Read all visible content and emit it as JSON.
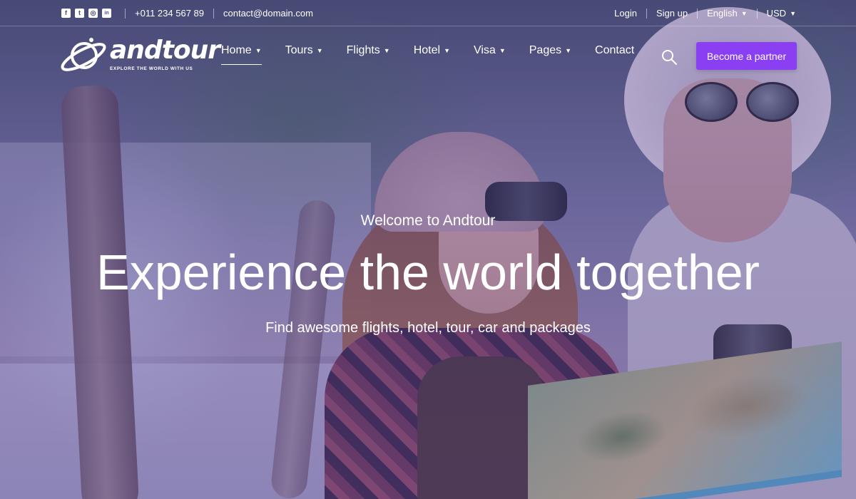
{
  "topbar": {
    "social": [
      {
        "icon": "facebook-icon",
        "glyph": "f"
      },
      {
        "icon": "twitter-icon",
        "glyph": "t"
      },
      {
        "icon": "instagram-icon",
        "glyph": "◎"
      },
      {
        "icon": "linkedin-icon",
        "glyph": "in"
      }
    ],
    "phone": "+011 234 567 89",
    "email": "contact@domain.com",
    "login": "Login",
    "signup": "Sign up",
    "language": "English",
    "currency": "USD"
  },
  "brand": {
    "name": "andtour",
    "tagline": "EXPLORE THE WORLD WITH US"
  },
  "nav": {
    "items": [
      {
        "label": "Home",
        "dropdown": true,
        "active": true
      },
      {
        "label": "Tours",
        "dropdown": true
      },
      {
        "label": "Flights",
        "dropdown": true
      },
      {
        "label": "Hotel",
        "dropdown": true
      },
      {
        "label": "Visa",
        "dropdown": true
      },
      {
        "label": "Pages",
        "dropdown": true
      },
      {
        "label": "Contact",
        "dropdown": false
      }
    ],
    "cta": "Become a partner"
  },
  "hero": {
    "welcome": "Welcome to Andtour",
    "headline": "Experience the world together",
    "subtitle": "Find awesome flights, hotel, tour, car and packages"
  },
  "colors": {
    "accent": "#8a3ff2",
    "overlay": "#5a3c96"
  }
}
